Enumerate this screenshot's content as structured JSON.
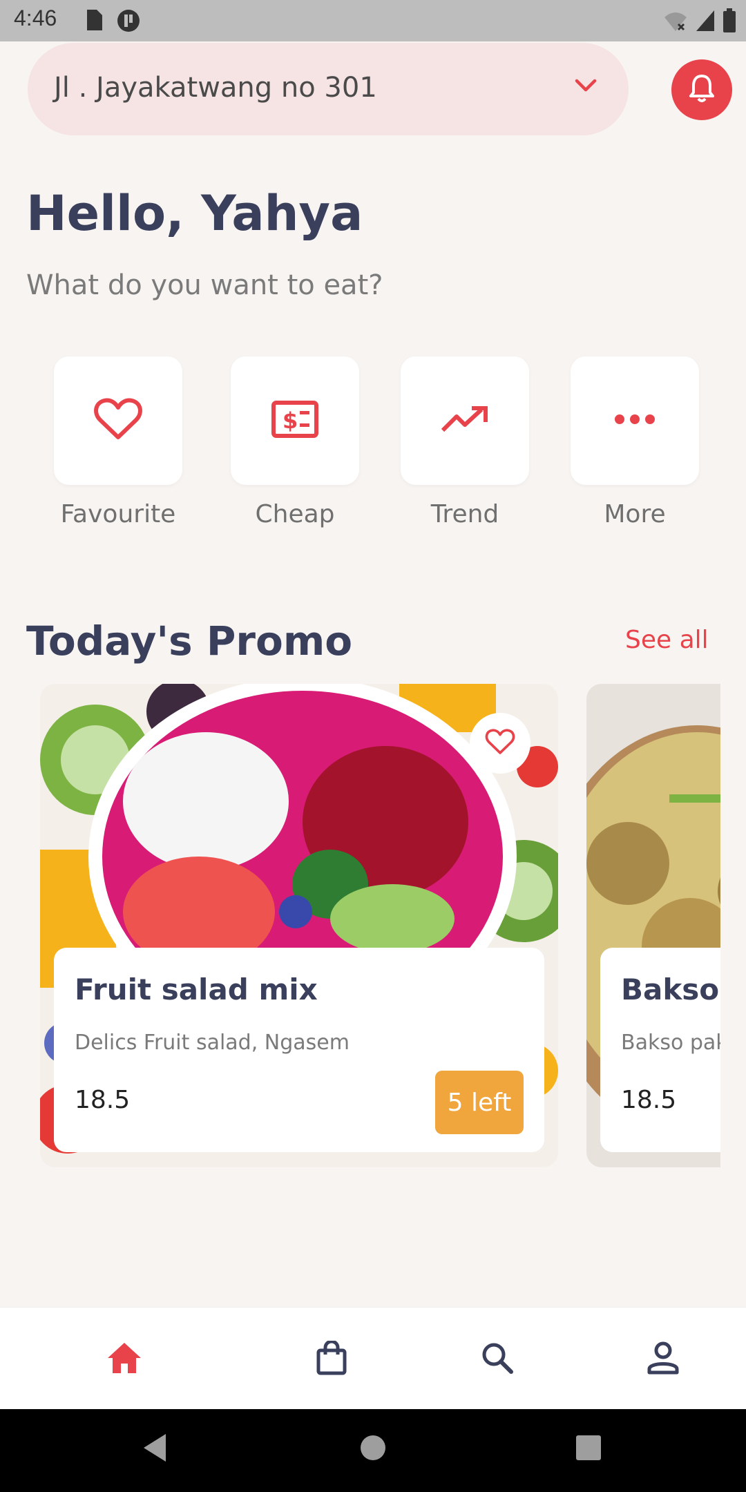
{
  "status_bar": {
    "time": "4:46",
    "left_icons": [
      "sd-card-icon",
      "app-notification-icon"
    ],
    "right_icons": [
      "wifi-off-icon",
      "cell-signal-icon",
      "battery-icon"
    ]
  },
  "header": {
    "address": "Jl . Jayakatwang no 301",
    "dropdown_icon": "chevron-down-icon",
    "notification_icon": "bell-icon"
  },
  "greeting": {
    "title": "Hello, Yahya",
    "subtitle": "What do you want to eat?"
  },
  "categories": [
    {
      "label": "Favourite",
      "icon": "heart-icon"
    },
    {
      "label": "Cheap",
      "icon": "price-tag-icon"
    },
    {
      "label": "Trend",
      "icon": "trending-up-icon"
    },
    {
      "label": "More",
      "icon": "more-dots-icon"
    }
  ],
  "promo": {
    "title": "Today's Promo",
    "see_all": "See all",
    "items": [
      {
        "name": "Fruit salad mix",
        "place": "Delics Fruit salad, Ngasem",
        "price": "18.5",
        "stock": "5 left"
      },
      {
        "name": "Bakso jumbo",
        "place": "Bakso pak ...",
        "price": "18.5",
        "stock": ""
      }
    ]
  },
  "bottom_nav": [
    {
      "icon": "home-icon",
      "active": true
    },
    {
      "icon": "shopping-bag-icon",
      "active": false
    },
    {
      "icon": "search-icon",
      "active": false
    },
    {
      "icon": "profile-icon",
      "active": false
    }
  ],
  "colors": {
    "accent": "#e8434a",
    "background": "#f8f4f2",
    "heading": "#3a3f5c",
    "stock_badge": "#f0a63c",
    "address_pill": "#f5e4e3"
  }
}
